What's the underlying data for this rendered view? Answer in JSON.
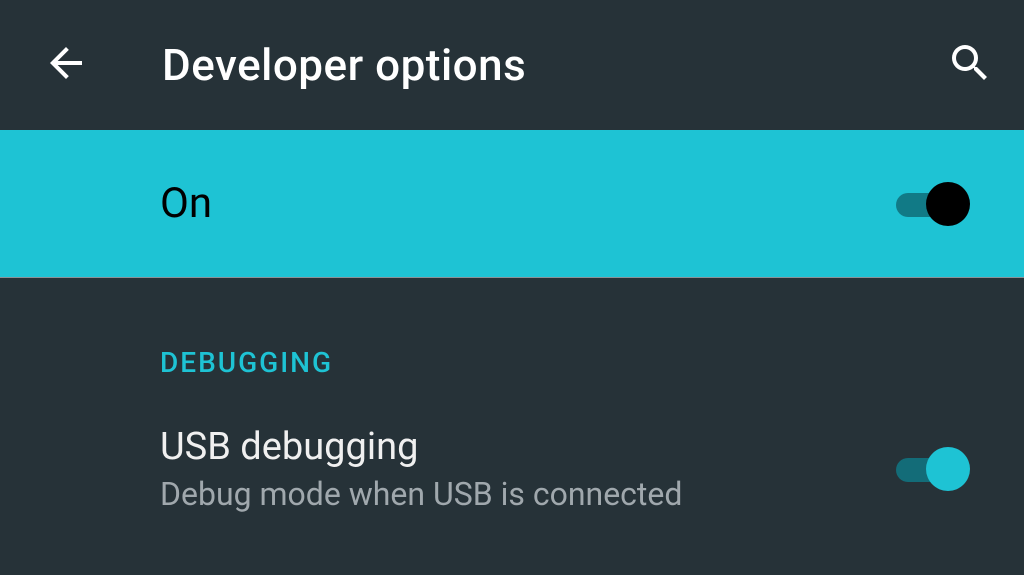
{
  "header": {
    "title": "Developer options"
  },
  "master": {
    "label": "On",
    "on": true
  },
  "sections": {
    "debugging": {
      "header": "Debugging",
      "usb": {
        "title": "USB debugging",
        "subtitle": "Debug mode when USB is connected",
        "on": true
      }
    }
  },
  "colors": {
    "background": "#263238",
    "accent": "#1EC3D4",
    "text": "#ffffff",
    "subtext": "#a0a8ad"
  }
}
